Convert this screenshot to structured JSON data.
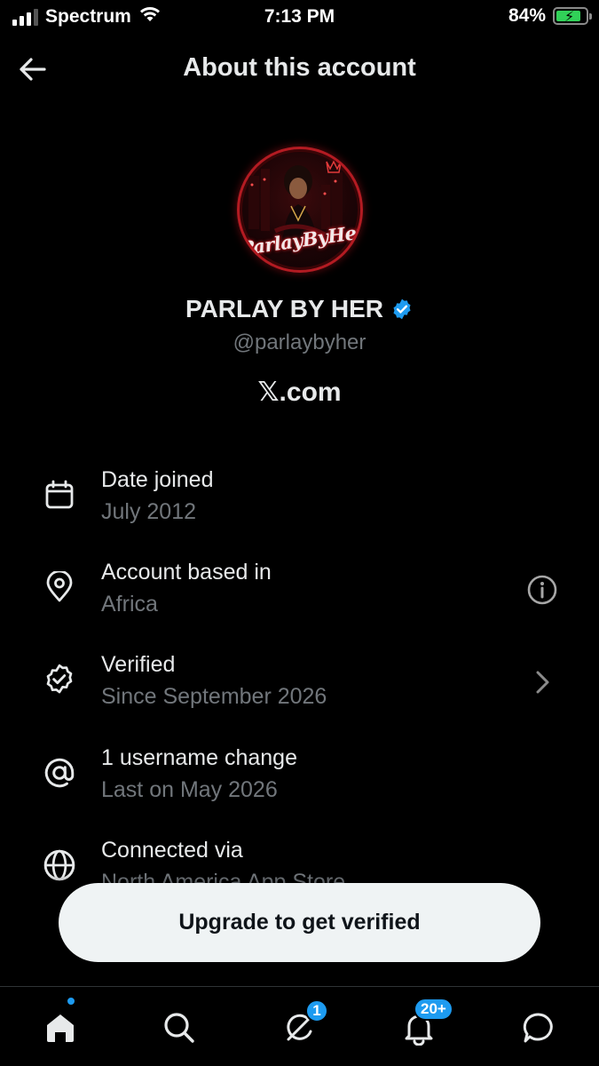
{
  "status_bar": {
    "carrier": "Spectrum",
    "time": "7:13 PM",
    "battery_percent": "84%",
    "battery_level": 0.84,
    "signal_bars": 3
  },
  "header": {
    "title": "About this account",
    "back_icon": "arrow-left-icon"
  },
  "profile": {
    "avatar_logo_text": "ParlayByHer",
    "display_name": "PARLAY BY HER",
    "verified_badge_color": "#1d9bf0",
    "handle": "@parlaybyher",
    "domain": "𝕏.com"
  },
  "info": {
    "date_joined": {
      "title": "Date joined",
      "value": "July 2012",
      "icon": "calendar-icon"
    },
    "based_in": {
      "title": "Account based in",
      "value": "Africa",
      "icon": "location-pin-icon",
      "trailing_icon": "info-icon"
    },
    "verified": {
      "title": "Verified",
      "value": "Since September 2026",
      "icon": "verified-badge-icon",
      "trailing_icon": "chevron-right-icon"
    },
    "username_change": {
      "title": "1 username change",
      "value": "Last on May 2026",
      "icon": "at-sign-icon"
    },
    "connected_via": {
      "title": "Connected via",
      "value": "North America App Store",
      "icon": "globe-icon"
    }
  },
  "cta": {
    "label": "Upgrade to get verified"
  },
  "tab_bar": {
    "tabs": [
      {
        "name": "home",
        "icon": "home-icon",
        "active": true,
        "dot": true
      },
      {
        "name": "search",
        "icon": "search-icon"
      },
      {
        "name": "grok",
        "icon": "grok-icon",
        "badge": "1"
      },
      {
        "name": "notifications",
        "icon": "bell-icon",
        "badge": "20+"
      },
      {
        "name": "messages",
        "icon": "chat-bubble-icon"
      }
    ]
  },
  "colors": {
    "background": "#000000",
    "primary_text": "#e7e9ea",
    "secondary_text": "#71767b",
    "accent": "#1d9bf0",
    "button_bg": "#eff3f4"
  }
}
